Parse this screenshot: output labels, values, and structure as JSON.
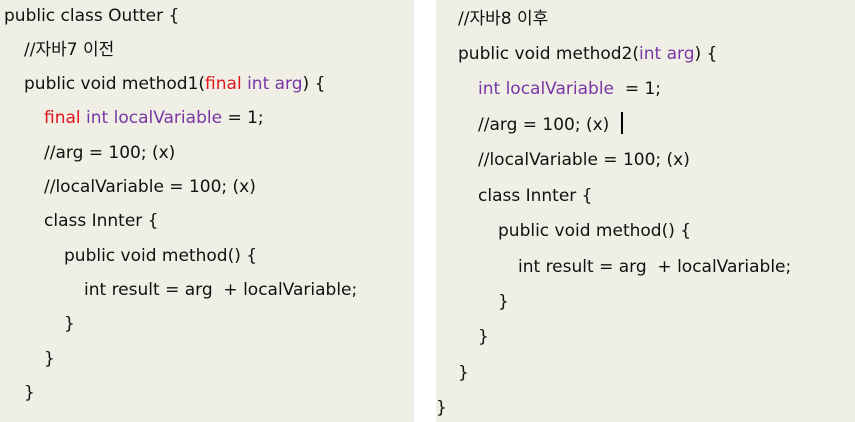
{
  "colors": {
    "default": "#111111",
    "keyword_red": "#e0161c",
    "type_purple": "#7a36a4"
  },
  "left": {
    "lines": [
      [
        {
          "t": "public class Outter {",
          "c": "d"
        }
      ],
      [
        {
          "t": "//자바7 이전",
          "c": "d"
        }
      ],
      [
        {
          "t": "public void method1(",
          "c": "d"
        },
        {
          "t": "final",
          "c": "r"
        },
        {
          "t": " int arg",
          "c": "p"
        },
        {
          "t": ") {",
          "c": "d"
        }
      ],
      [
        {
          "t": "final",
          "c": "r"
        },
        {
          "t": " int localVariable",
          "c": "p"
        },
        {
          "t": " = 1;",
          "c": "d"
        }
      ],
      [
        {
          "t": "//arg = 100; (x)",
          "c": "d"
        }
      ],
      [
        {
          "t": "//localVariable = 100; (x)",
          "c": "d"
        }
      ],
      [
        {
          "t": "class Innter {",
          "c": "d"
        }
      ],
      [
        {
          "t": "public void method() {",
          "c": "d"
        }
      ],
      [
        {
          "t": "int result = arg  + localVariable;",
          "c": "d"
        }
      ],
      [
        {
          "t": "}",
          "c": "d"
        }
      ],
      [
        {
          "t": "}",
          "c": "d"
        }
      ],
      [
        {
          "t": "}",
          "c": "d"
        }
      ]
    ]
  },
  "right": {
    "lines": [
      [
        {
          "t": "//자바8 이후",
          "c": "d"
        }
      ],
      [
        {
          "t": "public void method2(",
          "c": "d"
        },
        {
          "t": "int arg",
          "c": "p"
        },
        {
          "t": ") {",
          "c": "d"
        }
      ],
      [
        {
          "t": "int localVariable",
          "c": "p"
        },
        {
          "t": "  = 1;",
          "c": "d"
        }
      ],
      [
        {
          "t": "//arg = 100; (x)",
          "c": "d"
        }
      ],
      [
        {
          "t": "//localVariable = 100; (x)",
          "c": "d"
        }
      ],
      [
        {
          "t": "class Innter {",
          "c": "d"
        }
      ],
      [
        {
          "t": "public void method() {",
          "c": "d"
        }
      ],
      [
        {
          "t": "int result = arg  + localVariable;",
          "c": "d"
        }
      ],
      [
        {
          "t": "}",
          "c": "d"
        }
      ],
      [
        {
          "t": "}",
          "c": "d"
        }
      ],
      [
        {
          "t": "}",
          "c": "d"
        }
      ],
      [
        {
          "t": "}",
          "c": "d"
        }
      ]
    ]
  }
}
